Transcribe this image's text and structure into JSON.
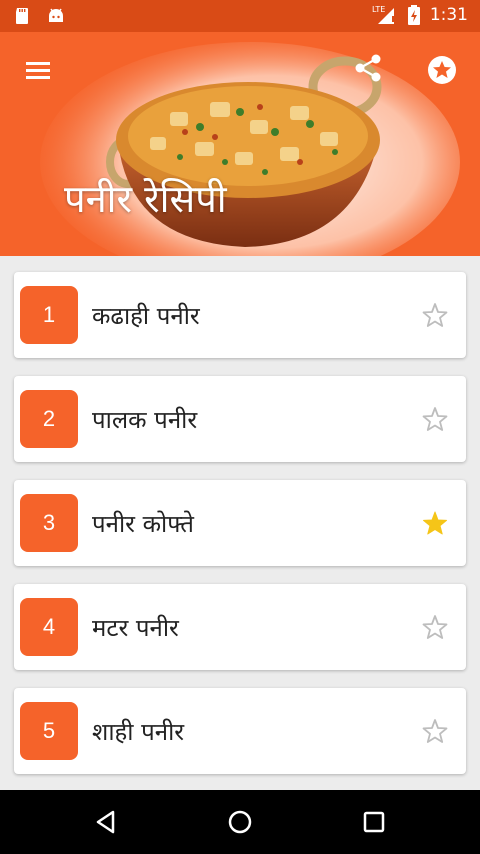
{
  "status_bar": {
    "time": "1:31",
    "network": "LTE",
    "icons": [
      "sd-card-icon",
      "android-icon",
      "signal-icon",
      "battery-charging-icon"
    ]
  },
  "header": {
    "title": "पनीर रेसिपी",
    "menu_icon": "hamburger-menu-icon",
    "share_icon": "share-icon",
    "favorite_icon": "star-circle-icon"
  },
  "recipes": [
    {
      "number": "1",
      "name": "कढाही पनीर",
      "favorited": false
    },
    {
      "number": "2",
      "name": "पालक पनीर",
      "favorited": false
    },
    {
      "number": "3",
      "name": "पनीर कोफ्ते",
      "favorited": true
    },
    {
      "number": "4",
      "name": "मटर पनीर",
      "favorited": false
    },
    {
      "number": "5",
      "name": "शाही पनीर",
      "favorited": false
    }
  ],
  "colors": {
    "accent": "#f5632a",
    "status_bar": "#d94b16",
    "star_active": "#f5c518",
    "star_inactive": "#bdbdbd"
  },
  "nav_bar": {
    "back_icon": "back-triangle-icon",
    "home_icon": "home-circle-icon",
    "recents_icon": "recents-square-icon"
  }
}
